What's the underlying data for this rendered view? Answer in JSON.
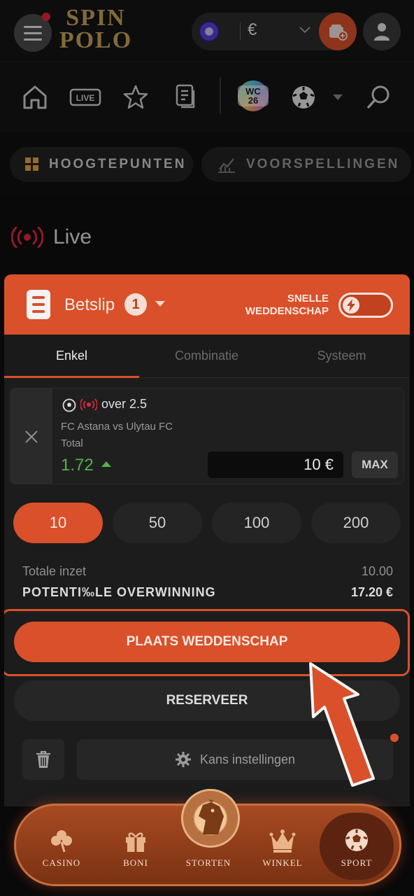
{
  "header": {
    "logo_line1": "SPIN",
    "logo_line2": "POLO",
    "currency": "€"
  },
  "nav_icons": [
    "home-icon",
    "live-icon",
    "star-icon",
    "docs-icon",
    "wc26-icon",
    "soccer-icon",
    "search-icon"
  ],
  "wc_badge": "WC 26",
  "pills": {
    "highlights": "HOOGTEPUNTEN",
    "predictions": "VOORSPELLINGEN"
  },
  "live_section": {
    "title": "Live"
  },
  "betslip": {
    "title": "Betslip",
    "count": "1",
    "quick_bet_label": "SNELLE WEDDENSCHAP",
    "tabs": [
      "Enkel",
      "Combinatie",
      "Systeem"
    ],
    "selection": {
      "market": "over 2.5",
      "match": "FC Astana vs Ulytau FC",
      "bet_type": "Total",
      "odds": "1.72",
      "stake": "10 €",
      "max_label": "MAX"
    },
    "quick_stakes": [
      "10",
      "50",
      "100",
      "200"
    ],
    "total_stake_label": "Totale inzet",
    "total_stake_value": "10.00",
    "potential_win_label": "POTENTI‰LE OVERWINNING",
    "potential_win_value": "17.20 €",
    "place_bet_label": "PLAATS WEDDENSCHAP",
    "reserve_label": "RESERVEER",
    "odds_settings_label": "Kans instellingen"
  },
  "bottom_nav": {
    "casino": "CASINO",
    "boni": "BONI",
    "storten": "STORTEN",
    "winkel": "WINKEL",
    "sport": "SPORT"
  },
  "colors": {
    "accent": "#d9502a",
    "odds_up": "#52b34b",
    "live_red": "#e0283a",
    "background": "#0f0f0f"
  }
}
